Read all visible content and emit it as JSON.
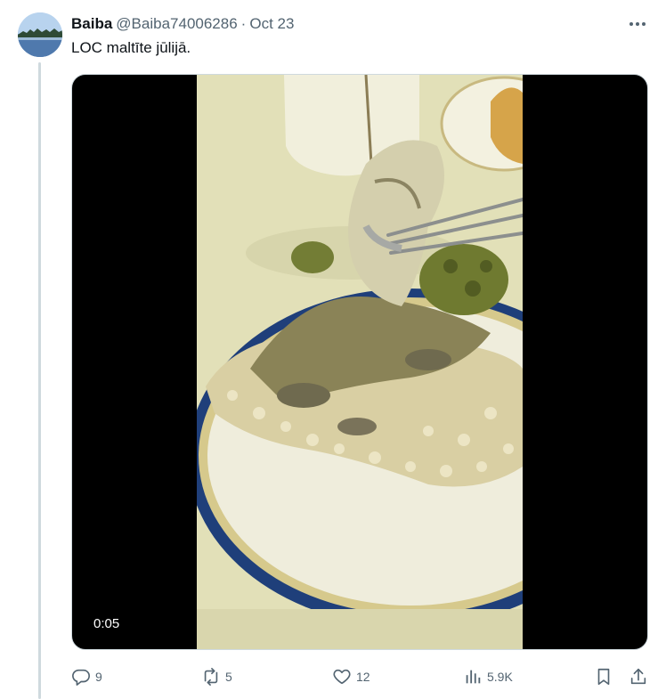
{
  "tweet": {
    "author_name": "Baiba",
    "handle": "@Baiba74006286",
    "separator": "·",
    "date": "Oct 23",
    "text": "LOC maltīte jūlijā."
  },
  "media": {
    "type": "video",
    "timestamp": "0:05"
  },
  "actions": {
    "replies": "9",
    "reposts": "5",
    "likes": "12",
    "views": "5.9K"
  },
  "icons": {
    "more": "more-horizontal-icon",
    "reply": "reply-icon",
    "repost": "repost-icon",
    "like": "heart-icon",
    "views": "views-icon",
    "bookmark": "bookmark-icon",
    "share": "share-icon"
  },
  "colors": {
    "text_primary": "#0f1419",
    "text_secondary": "#536471",
    "border": "#cfd9de"
  }
}
